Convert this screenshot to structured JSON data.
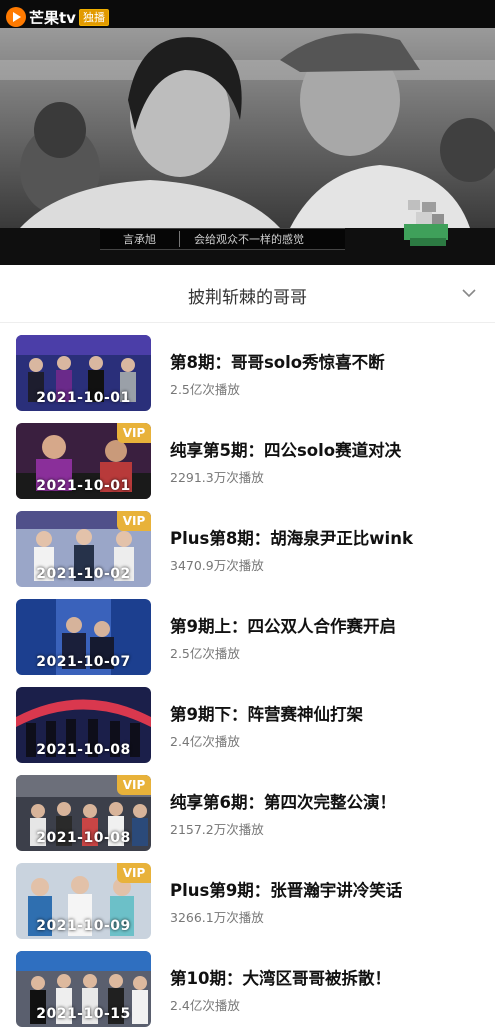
{
  "player": {
    "logo_text": "芒果tv",
    "logo_badge": "独播",
    "subtitle_name": "言承旭",
    "subtitle_text": "会给观众不一样的感觉"
  },
  "playlist": {
    "title": "披荆斩棘的哥哥",
    "vip_label": "VIP",
    "episodes": [
      {
        "title": "第8期：哥哥solo秀惊喜不断",
        "views": "2.5亿次播放",
        "date": "2021-10-01",
        "vip": false
      },
      {
        "title": "纯享第5期：四公solo赛道对决",
        "views": "2291.3万次播放",
        "date": "2021-10-01",
        "vip": true
      },
      {
        "title": "Plus第8期：胡海泉尹正比wink",
        "views": "3470.9万次播放",
        "date": "2021-10-02",
        "vip": true
      },
      {
        "title": "第9期上：四公双人合作赛开启",
        "views": "2.5亿次播放",
        "date": "2021-10-07",
        "vip": false
      },
      {
        "title": "第9期下：阵营赛神仙打架",
        "views": "2.4亿次播放",
        "date": "2021-10-08",
        "vip": false
      },
      {
        "title": "纯享第6期：第四次完整公演！",
        "views": "2157.2万次播放",
        "date": "2021-10-08",
        "vip": true
      },
      {
        "title": "Plus第9期：张晋瀚宇讲冷笑话",
        "views": "3266.1万次播放",
        "date": "2021-10-09",
        "vip": true
      },
      {
        "title": "第10期：大湾区哥哥被拆散！",
        "views": "2.4亿次播放",
        "date": "2021-10-15",
        "vip": false
      }
    ]
  },
  "colors": {
    "vip_badge": "#e8b23a",
    "logo_orange": "#ff7a00"
  }
}
